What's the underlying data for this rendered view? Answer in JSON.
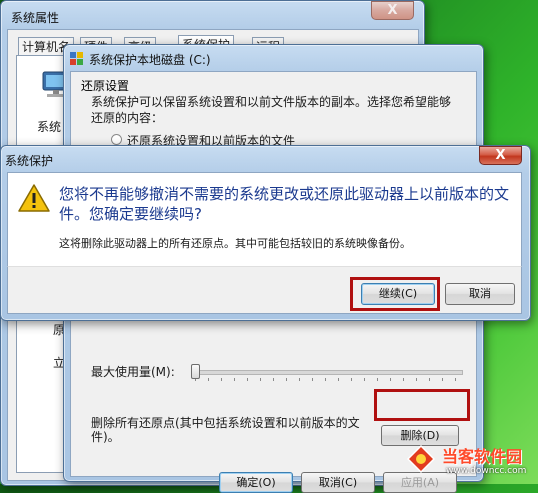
{
  "sysprops": {
    "title": "系统属性",
    "close_label": "X",
    "tabs": [
      "计算机名",
      "硬件",
      "高级",
      "系统保护",
      "远程"
    ],
    "left_fragments": [
      "系统",
      "原点",
      "立刻"
    ]
  },
  "disk_dialog": {
    "title": "系统保护本地磁盘 (C:)",
    "section_title": "还原设置",
    "description": "系统保护可以保留系统设置和以前文件版本的副本。选择您希望能够还原的内容：",
    "radio1": "还原系统设置和以前版本的文件",
    "max_usage_label": "最大使用量(M):",
    "delete_desc": "删除所有还原点(其中包括系统设置和以前版本的文件)。",
    "delete_button": "删除(D)",
    "ok_button": "确定(O)",
    "cancel_button": "取消(C)",
    "apply_button": "应用(A)"
  },
  "confirm_dialog": {
    "title": "系统保护",
    "close_label": "X",
    "main_instruction": "您将不再能够撤消不需要的系统更改或还原此驱动器上以前版本的文件。您确定要继续吗?",
    "detail": "这将删除此驱动器上的所有还原点。其中可能包括较旧的系统映像备份。",
    "continue_button": "继续(C)",
    "cancel_button": "取消"
  },
  "watermark": {
    "site_name": "当客软件园",
    "url": "www.downcc.com"
  },
  "colors": {
    "highlight_box": "#b01010",
    "instruction_text": "#1b3a8f",
    "desktop_green": "#2fb32a"
  },
  "icons": [
    "computer-icon",
    "shield-icon",
    "warning-icon",
    "close-icon",
    "slider-thumb-icon"
  ]
}
